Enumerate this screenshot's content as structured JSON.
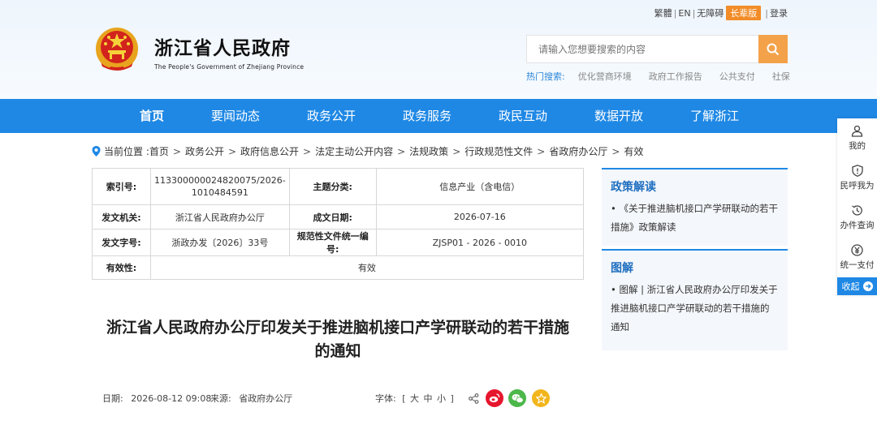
{
  "topbar": {
    "traditional": "繁體",
    "english": "EN",
    "accessible": "无障碍",
    "elder": "长辈版",
    "login": "登录"
  },
  "site": {
    "title": "浙江省人民政府",
    "subtitle": "The People's Government of Zhejiang Province"
  },
  "search": {
    "placeholder": "请输入您想要搜索的内容",
    "hot_label": "热门搜索:",
    "hot_keywords": [
      "优化营商环境",
      "政府工作报告",
      "公共支付",
      "社保"
    ]
  },
  "nav": [
    "首页",
    "要闻动态",
    "政务公开",
    "政务服务",
    "政民互动",
    "数据开放",
    "了解浙江"
  ],
  "breadcrumb": {
    "label": "当前位置 :",
    "items": [
      "首页",
      "政务公开",
      "政府信息公开",
      "法定主动公开内容",
      "法规政策",
      "行政规范性文件",
      "省政府办公厅",
      "有效"
    ]
  },
  "meta": {
    "index_label": "索引号:",
    "index_value": "113300000024820075/2026-1010484591",
    "topic_label": "主题分类:",
    "topic_value": "信息产业（含电信）",
    "issuer_label": "发文机关:",
    "issuer_value": "浙江省人民政府办公厅",
    "date_label": "成文日期:",
    "date_value": "2026-07-16",
    "docno_label": "发文字号:",
    "docno_value": "浙政办发〔2026〕33号",
    "code_label": "规范性文件统一编号:",
    "code_value": "ZJSP01 - 2026 - 0010",
    "valid_label": "有效性:",
    "valid_value": "有效"
  },
  "article": {
    "title_line1": "浙江省人民政府办公厅印发关于推进脑机接口产学研联动的若干措施",
    "title_line2": "的通知",
    "date_label": "日期:",
    "date_value": "2026-08-12 09:08",
    "source_label": "来源:",
    "source_value": "省政府办公厅",
    "font_label": "字体:",
    "font_open": "[",
    "font_large": "大",
    "font_medium": "中",
    "font_small": "小",
    "font_close": "]"
  },
  "policy_panel": {
    "heading": "政策解读",
    "item": "《关于推进脑机接口产学研联动的若干措施》政策解读"
  },
  "graphic_panel": {
    "heading": "图解",
    "item": "图解 | 浙江省人民政府办公厅印发关于推进脑机接口产学研联动的若干措施的通知"
  },
  "sidebar": {
    "items": [
      "我的",
      "民呼我为",
      "办件查询",
      "统一支付"
    ],
    "fold": "收起"
  },
  "colors": {
    "primary": "#1f88e5",
    "accent": "#f4a24a",
    "weibo": "#e6162d",
    "wechat": "#4cb74a",
    "favorite": "#f2b61c"
  },
  "icons": [
    "emblem-icon",
    "search-icon",
    "location-pin-icon",
    "share-icon",
    "weibo-icon",
    "wechat-icon",
    "favorite-icon",
    "user-icon",
    "shield-icon",
    "history-icon",
    "yuan-icon",
    "arrow-right-icon"
  ]
}
